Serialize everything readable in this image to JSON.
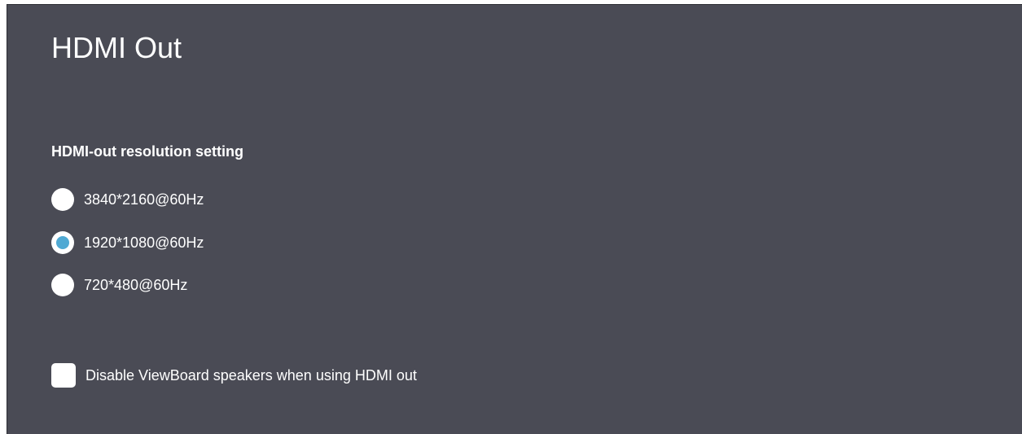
{
  "page": {
    "title": "HDMI Out"
  },
  "resolution": {
    "heading": "HDMI-out resolution setting",
    "options": [
      {
        "label": "3840*2160@60Hz",
        "selected": false
      },
      {
        "label": "1920*1080@60Hz",
        "selected": true
      },
      {
        "label": "720*480@60Hz",
        "selected": false
      }
    ]
  },
  "speakers": {
    "label": "Disable ViewBoard speakers when using HDMI out",
    "checked": false
  },
  "colors": {
    "panel_background": "#4a4b55",
    "accent": "#4fa9d3",
    "text": "#ffffff"
  }
}
